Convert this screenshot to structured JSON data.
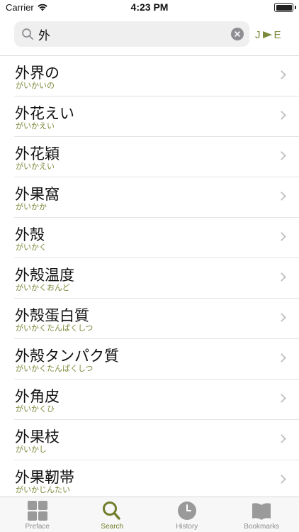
{
  "status": {
    "carrier": "Carrier",
    "time": "4:23 PM"
  },
  "search": {
    "query": "外",
    "placeholder": "",
    "lang_from": "J",
    "lang_to": "E"
  },
  "results": [
    {
      "word": "外界の",
      "reading": "がいかいの"
    },
    {
      "word": "外花えい",
      "reading": "がいかえい"
    },
    {
      "word": "外花穎",
      "reading": "がいかえい"
    },
    {
      "word": "外果窩",
      "reading": "がいかか"
    },
    {
      "word": "外殻",
      "reading": "がいかく"
    },
    {
      "word": "外殻温度",
      "reading": "がいかくおんど"
    },
    {
      "word": "外殻蛋白質",
      "reading": "がいかくたんぱくしつ"
    },
    {
      "word": "外殻タンパク質",
      "reading": "がいかくたんぱくしつ"
    },
    {
      "word": "外角皮",
      "reading": "がいかくひ"
    },
    {
      "word": "外果枝",
      "reading": "がいかし"
    },
    {
      "word": "外果靭帯",
      "reading": "がいかじんたい"
    }
  ],
  "tabs": [
    {
      "label": "Preface",
      "icon": "grid-icon",
      "active": false
    },
    {
      "label": "Search",
      "icon": "magnifier-icon",
      "active": true
    },
    {
      "label": "History",
      "icon": "clock-icon",
      "active": false
    },
    {
      "label": "Bookmarks",
      "icon": "book-icon",
      "active": false
    }
  ],
  "colors": {
    "accent": "#7b8a3a",
    "tab_inactive": "#8e8e93"
  }
}
